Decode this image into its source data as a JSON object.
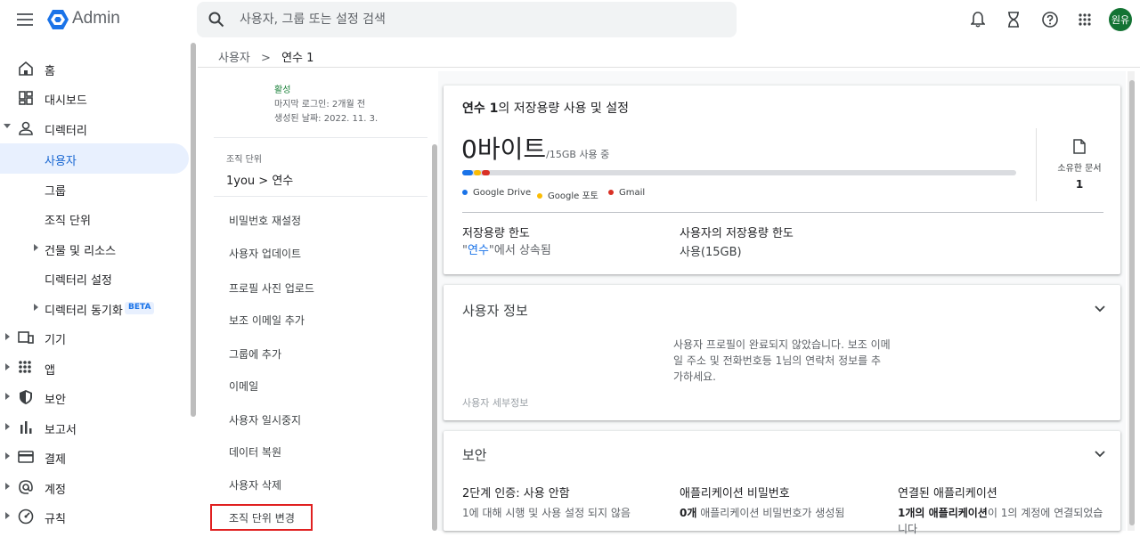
{
  "app": {
    "title": "Admin",
    "avatar": "원유"
  },
  "search": {
    "placeholder": "사용자, 그룹 또는 설정 검색"
  },
  "nav": {
    "home": "홈",
    "dashboard": "대시보드",
    "directory": "디렉터리",
    "users": "사용자",
    "groups": "그룹",
    "org_units": "조직 단위",
    "buildings": "건물 및 리소스",
    "directory_settings": "디렉터리 설정",
    "directory_sync": "디렉터리 동기화",
    "beta": "BETA",
    "devices": "기기",
    "apps": "앱",
    "security": "보안",
    "reports": "보고서",
    "billing": "결제",
    "account": "계정",
    "rules": "규칙"
  },
  "breadcrumb": {
    "parent": "사용자",
    "separator": ">",
    "current": "연수 1"
  },
  "user_panel": {
    "status": "활성",
    "last_login": "마지막 로그인: 2개월 전",
    "created": "생성된 날짜: 2022. 11. 3.",
    "ou_label": "조직 단위",
    "ou_path": "1you  >  연수",
    "actions": [
      "비밀번호 재설정",
      "사용자 업데이트",
      "프로필 사진 업로드",
      "보조 이메일 추가",
      "그룹에 추가",
      "이메일",
      "사용자 일시중지",
      "데이터 복원",
      "사용자 삭제",
      "조직 단위 변경"
    ]
  },
  "storage": {
    "title_bold": "연수 1",
    "title_rest": "의 저장용량 사용 및 설정",
    "used": "0바이트",
    "quota": "/15GB 사용 중",
    "legend": [
      {
        "name": "Google Drive",
        "color": "#1a73e8"
      },
      {
        "name": "Google 포토",
        "color": "#fbbc04"
      },
      {
        "name": "Gmail",
        "color": "#d93025"
      }
    ],
    "owned_docs_label": "소유한 문서",
    "owned_docs_count": "1",
    "limit_label": "저장용량 한도",
    "limit_quote_open": "\"",
    "limit_link": "연수",
    "limit_inherited": "\"에서 상속됨",
    "user_limit_label": "사용자의 저장용량 한도",
    "user_limit_value": "사용(15GB)"
  },
  "user_info": {
    "title": "사용자 정보",
    "message": "사용자 프로필이 완료되지 않았습니다. 보조 이메일 주소 및 전화번호등 1님의 연락처 정보를 추가하세요.",
    "details": "사용자 세부정보"
  },
  "security": {
    "title": "보안",
    "two_step_label": "2단계 인증: 사용 안함",
    "two_step_desc": "1에 대해 시행 및 사용 설정 되지 않음",
    "app_password_label": "애플리케이션 비밀번호",
    "app_password_bold": "0개",
    "app_password_rest": " 애플리케이션 비밀번호가 생성됨",
    "connected_label": "연결된 애플리케이션",
    "connected_bold": "1개의 애플리케이션",
    "connected_rest": "이 1의 계정에 연결되었습니다"
  }
}
